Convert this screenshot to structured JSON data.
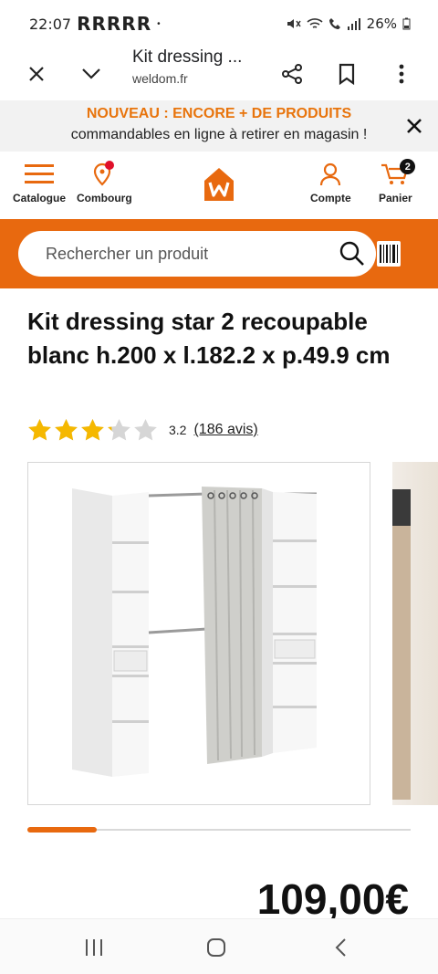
{
  "status_bar": {
    "time": "22:07",
    "carrier": "RRRRR",
    "dot": "•",
    "battery": "26%"
  },
  "browser": {
    "title": "Kit dressing ...",
    "domain": "weldom.fr"
  },
  "promo": {
    "headline": "NOUVEAU : ENCORE + DE PRODUITS",
    "subline": "commandables en ligne à retirer en magasin !"
  },
  "header": {
    "catalogue_label": "Catalogue",
    "store_label": "Combourg",
    "account_label": "Compte",
    "cart_label": "Panier",
    "cart_count": "2"
  },
  "search": {
    "placeholder": "Rechercher un produit"
  },
  "product": {
    "title": "Kit dressing star 2 recoupable blanc h.200 x l.182.2 x p.49.9 cm",
    "rating_value": 3.2,
    "rating_text": "3.2",
    "reviews_text": "(186 avis)",
    "price": "109,00€",
    "gallery_progress": 0.18
  },
  "colors": {
    "brand_orange": "#e8690f",
    "promo_orange": "#e8740c",
    "star_yellow": "#f5b800",
    "star_empty": "#d6d6d6"
  },
  "icons": {
    "close": "close-icon",
    "chevron": "chevron-down-icon",
    "share": "share-icon",
    "bookmark": "bookmark-icon",
    "more": "more-vertical-icon",
    "menu": "hamburger-icon",
    "location": "location-pin-icon",
    "logo": "weldom-logo-icon",
    "account": "user-icon",
    "cart": "cart-icon",
    "search": "search-icon",
    "barcode": "barcode-icon"
  }
}
